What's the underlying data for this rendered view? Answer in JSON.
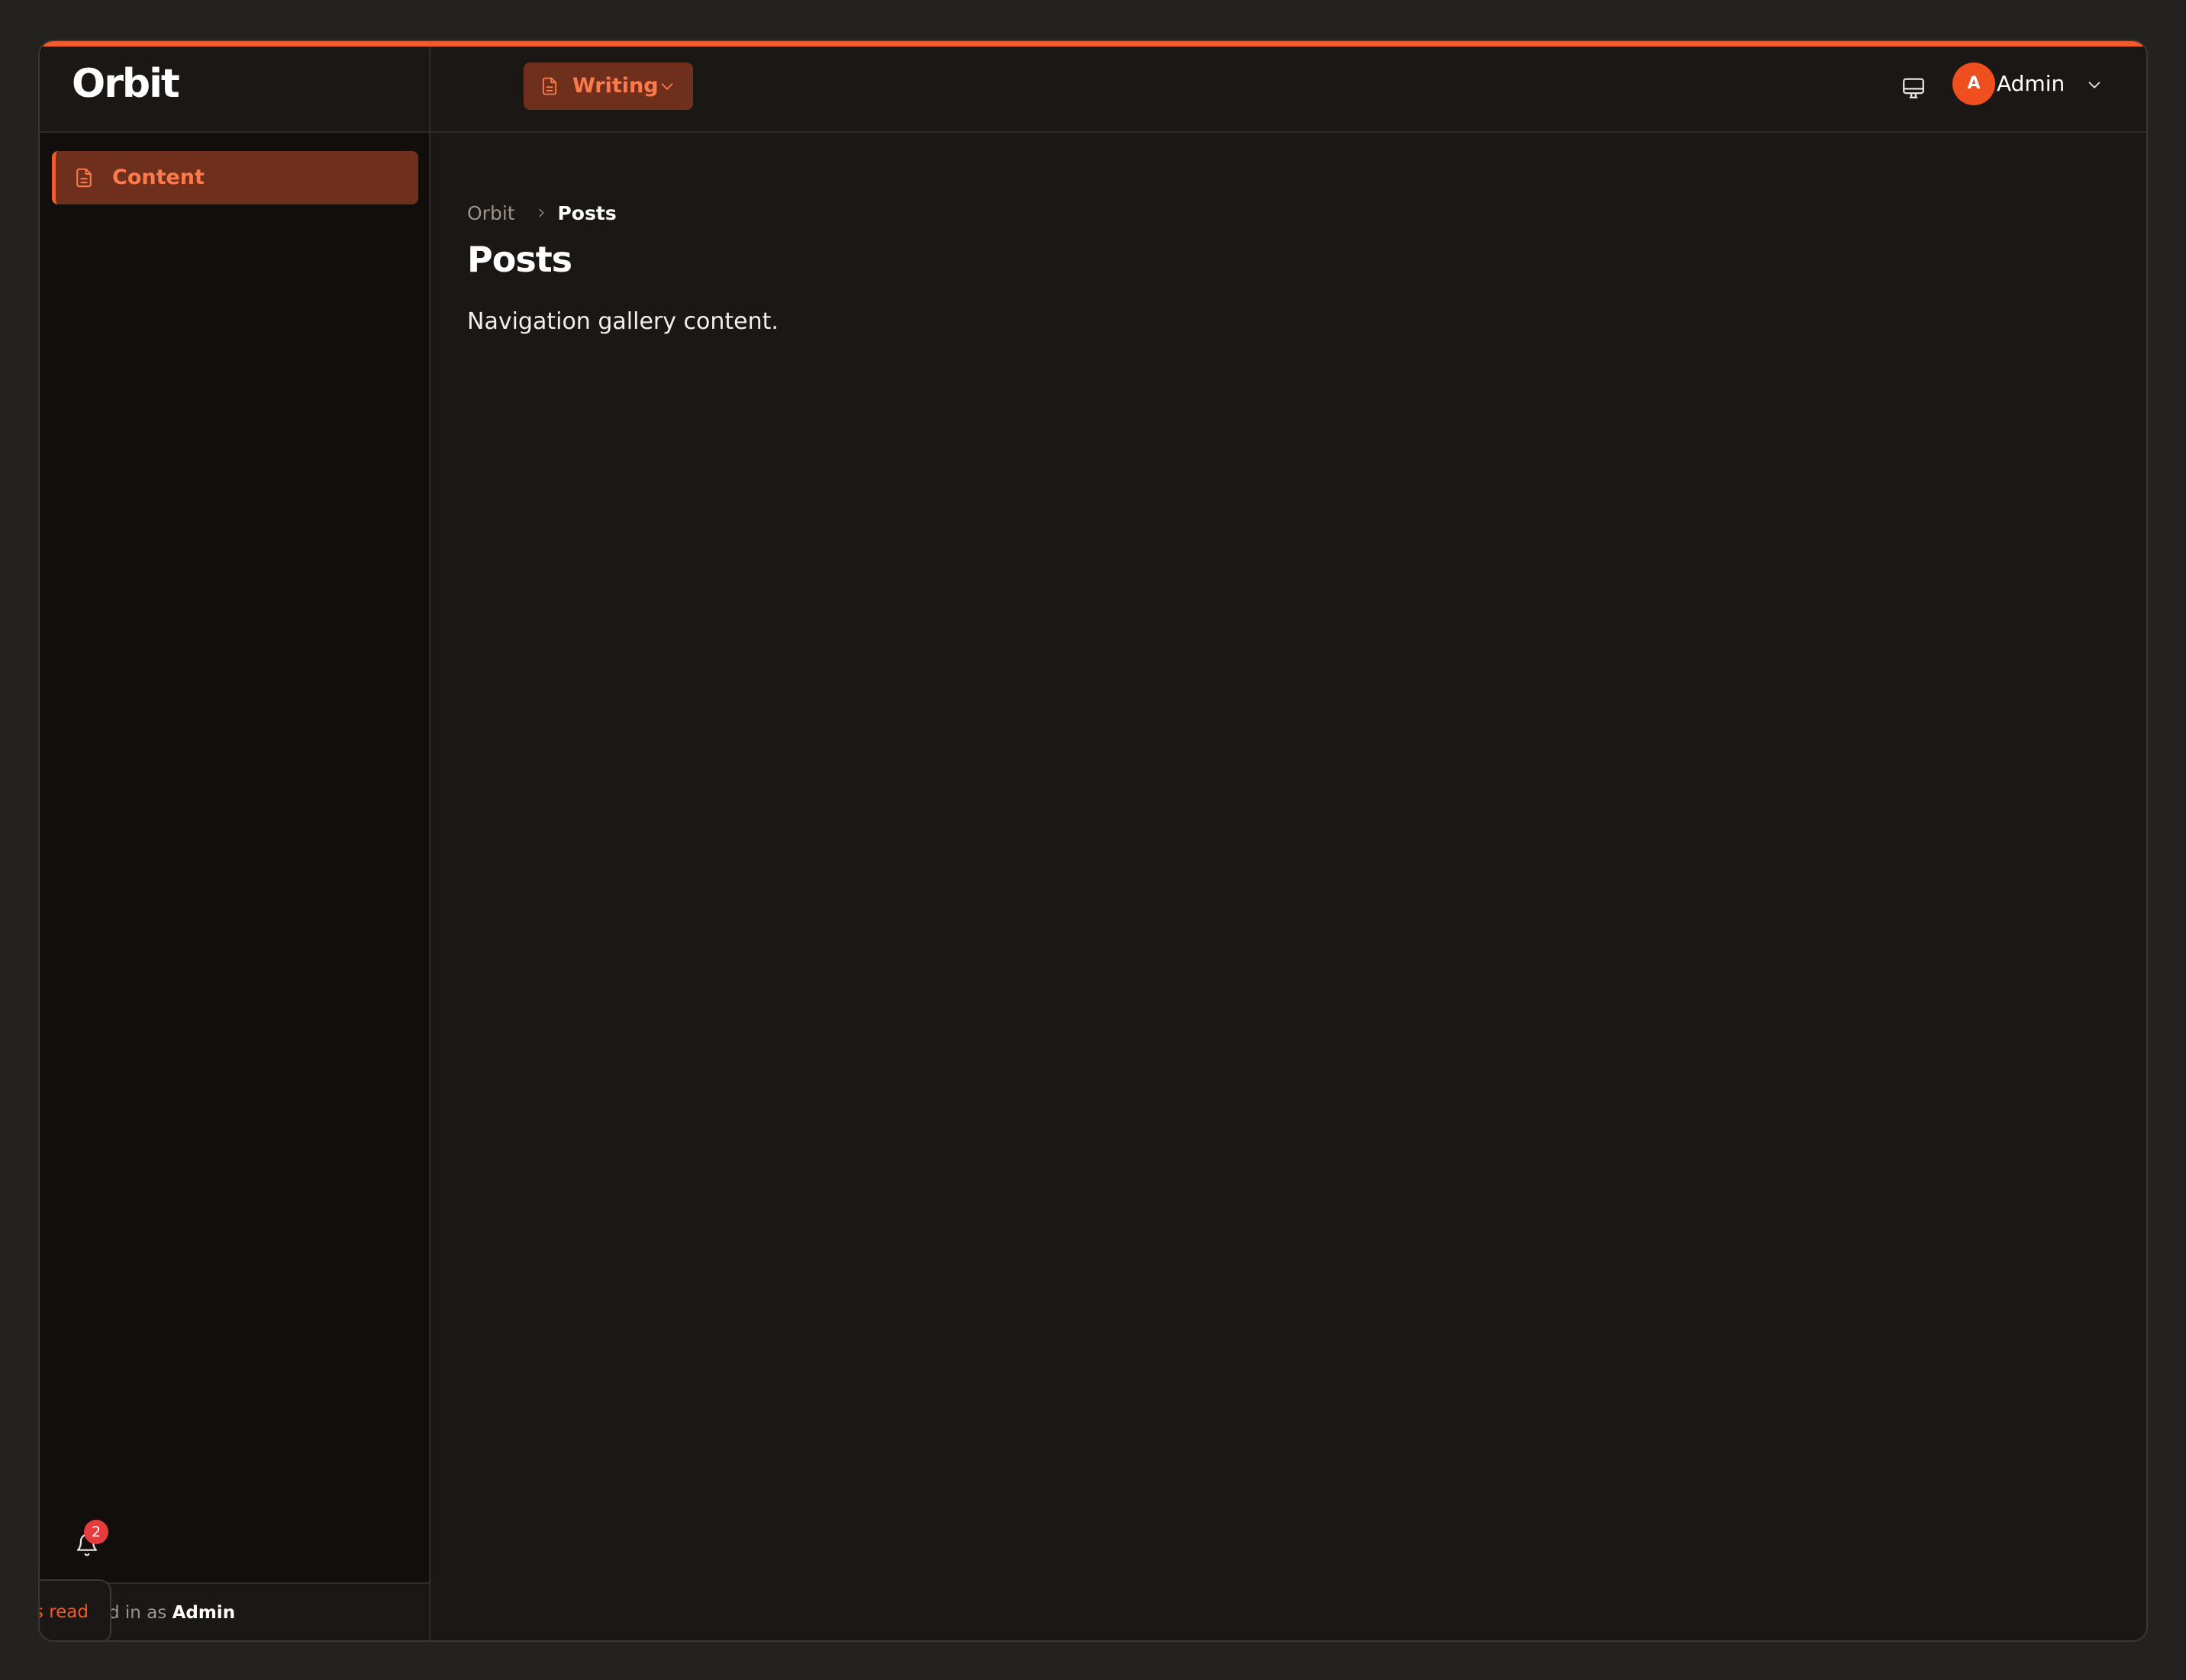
{
  "app": {
    "logo_text": "Orbit"
  },
  "sidebar": {
    "items": [
      {
        "label": "Content",
        "icon": "document-icon",
        "active": true
      }
    ],
    "notifications": {
      "count": "2",
      "icon": "bell-icon"
    },
    "footer": {
      "logged_in_prefix": "d in as ",
      "user": "Admin",
      "toast_text": "s read"
    }
  },
  "header": {
    "workspace": {
      "label": "Writing",
      "icon": "document-icon"
    },
    "display_icon": "monitor-icon",
    "user": {
      "initial": "A",
      "name": "Admin"
    }
  },
  "main": {
    "breadcrumb": [
      {
        "label": "Orbit"
      },
      {
        "label": "Posts"
      }
    ],
    "title": "Posts",
    "body": "Navigation gallery content."
  },
  "colors": {
    "accent": "#ef5b2b",
    "active_bg": "#6e2f1c",
    "background": "#1b1714",
    "sidebar_bg": "#120e0c",
    "badge": "#e53d3d"
  }
}
